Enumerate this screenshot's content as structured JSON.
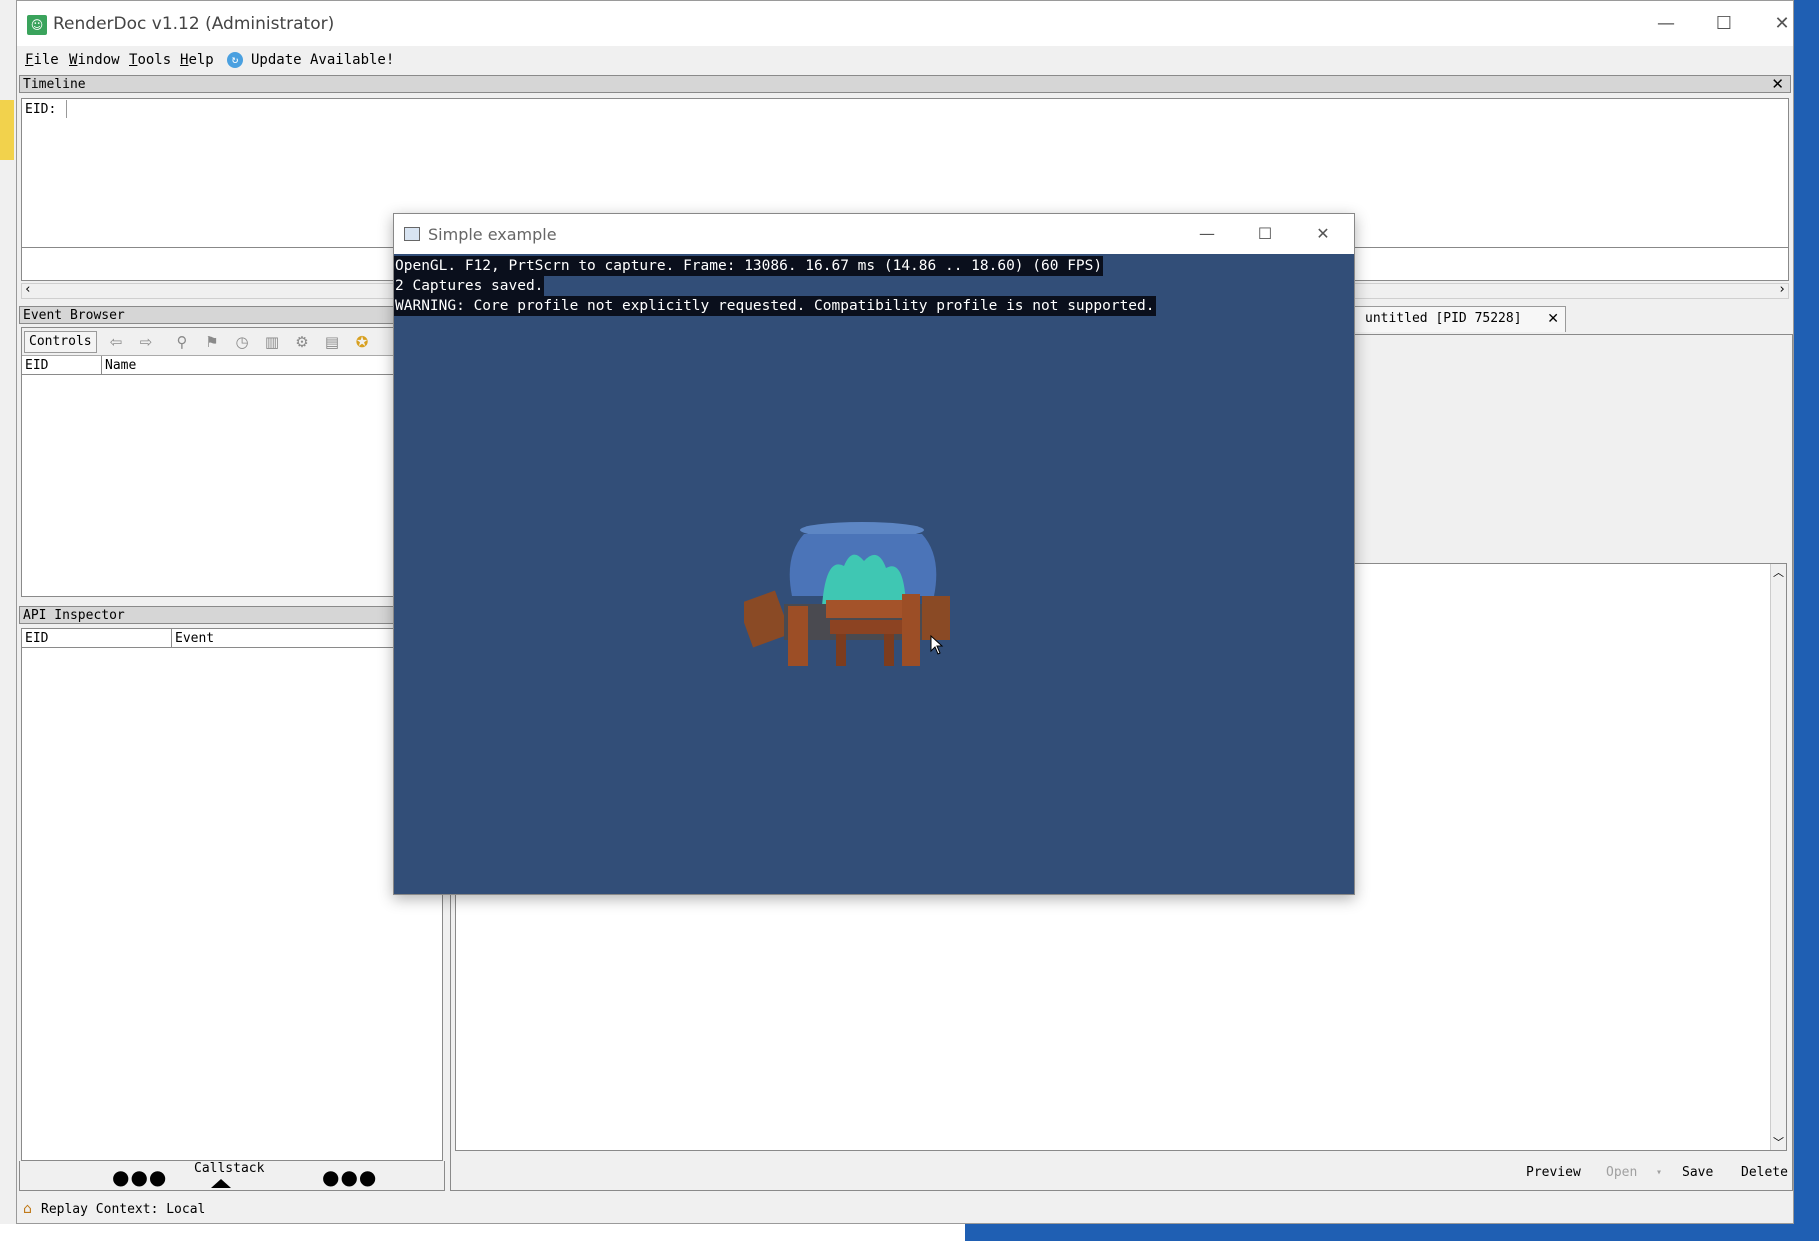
{
  "window": {
    "title": "RenderDoc v1.12 (Administrator)",
    "app_icon_glyph": "☺"
  },
  "menu": {
    "file": "File",
    "window": "Window",
    "tools": "Tools",
    "help": "Help",
    "update": "Update Available!"
  },
  "timeline": {
    "title": "Timeline",
    "eid_label": "EID:",
    "eid_value": ""
  },
  "event_browser": {
    "title": "Event Browser",
    "controls": "Controls",
    "col_eid": "EID",
    "col_name": "Name"
  },
  "api_inspector": {
    "title": "API Inspector",
    "col_eid": "EID",
    "col_event": "Event",
    "callstack": "Callstack",
    "dots": "●●●"
  },
  "capture_tab": {
    "label": "untitled [PID 75228]"
  },
  "right_buttons": {
    "preview": "Preview",
    "open": "Open",
    "save": "Save",
    "delete": "Delete"
  },
  "status": {
    "text": "Replay Context: Local"
  },
  "simple_example": {
    "title": "Simple example",
    "overlay": [
      "OpenGL. F12, PrtScrn to capture. Frame: 13086. 16.67 ms (14.86 .. 18.60) (60 FPS)",
      "2 Captures saved.",
      "WARNING: Core profile not explicitly requested. Compatibility profile is not supported."
    ],
    "background_color": "#324e78"
  },
  "colors": {
    "accent_green": "#3aa35c",
    "panel_header": "#d6d6d6",
    "desktop": "#1f5fb3"
  }
}
